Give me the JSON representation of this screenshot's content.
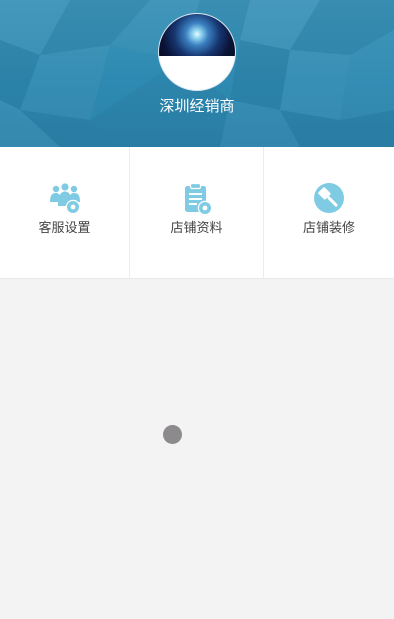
{
  "header": {
    "shop_name": "深圳经销商"
  },
  "menu": {
    "items": [
      {
        "label": "客服设置",
        "icon": "customer-service-settings-icon"
      },
      {
        "label": "店铺资料",
        "icon": "shop-info-clipboard-icon"
      },
      {
        "label": "店铺装修",
        "icon": "shop-decoration-brush-icon"
      }
    ]
  },
  "colors": {
    "header_background": "#2e8ab2",
    "icon_color": "#7fcbe3",
    "page_background": "#f3f3f3",
    "loader": "#8d8a8d"
  }
}
